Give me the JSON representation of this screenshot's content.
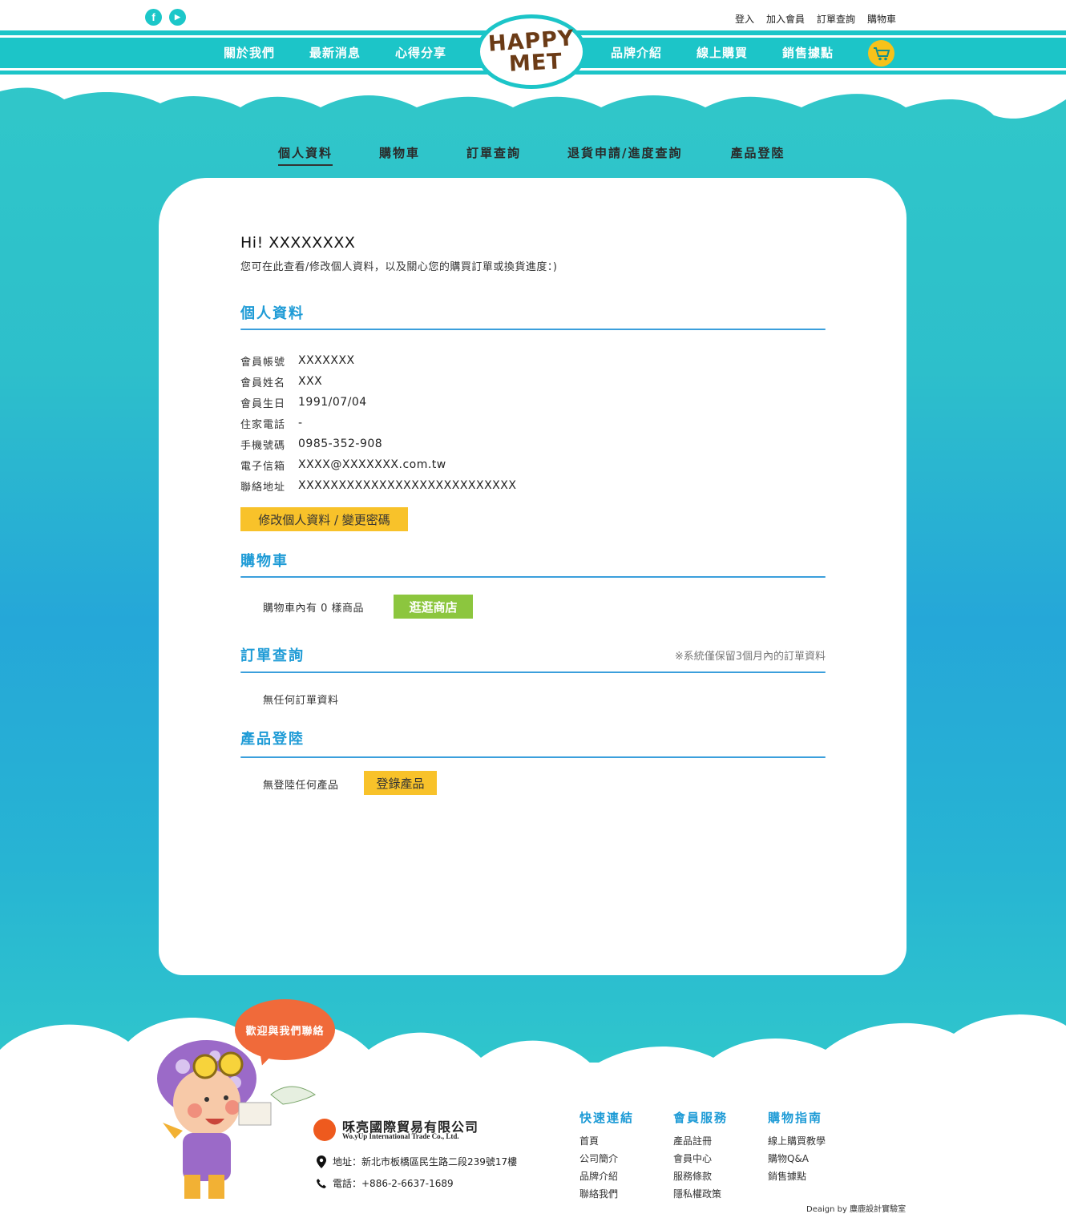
{
  "header": {
    "social": [
      {
        "icon": "facebook-icon",
        "glyph": "f"
      },
      {
        "icon": "youtube-icon",
        "glyph": "▶"
      }
    ],
    "top_links": [
      "登入",
      "加入會員",
      "訂單查詢",
      "購物車"
    ],
    "nav_left": [
      "關於我們",
      "最新消息",
      "心得分享"
    ],
    "nav_right": [
      "品牌介紹",
      "線上購買",
      "銷售據點"
    ],
    "logo": {
      "line1": "HAPPY",
      "line2": "MET"
    }
  },
  "subnav": {
    "items": [
      "個人資料",
      "購物車",
      "訂單查詢",
      "退貨申請/進度查詢",
      "產品登陸"
    ],
    "active": "個人資料"
  },
  "greeting": {
    "title": "Hi! XXXXXXXX",
    "subtitle": "您可在此查看/修改個人資料，以及關心您的購買訂單或換貨進度：)"
  },
  "profile": {
    "title": "個人資料",
    "rows": [
      {
        "label": "會員帳號",
        "value": "XXXXXXX"
      },
      {
        "label": "會員姓名",
        "value": "XXX"
      },
      {
        "label": "會員生日",
        "value": "1991/07/04"
      },
      {
        "label": "住家電話",
        "value": "-"
      },
      {
        "label": "手機號碼",
        "value": "0985-352-908"
      },
      {
        "label": "電子信箱",
        "value": "XXXX@XXXXXXX.com.tw"
      },
      {
        "label": "聯絡地址",
        "value": "XXXXXXXXXXXXXXXXXXXXXXXXXXX"
      }
    ],
    "edit_button": "修改個人資料 / 變更密碼"
  },
  "cart": {
    "title": "購物車",
    "text": "購物車內有 0 樣商品",
    "button": "逛逛商店"
  },
  "orders": {
    "title": "訂單查詢",
    "note": "※系統僅保留3個月內的訂單資料",
    "text": "無任何訂單資料"
  },
  "products": {
    "title": "產品登陸",
    "text": "無登陸任何產品",
    "button": "登錄產品"
  },
  "footer": {
    "bubble": "歡迎與我們聯絡",
    "company_name": "咊亮國際貿易有限公司",
    "company_en": "Wo.yUp International Trade Co., Ltd.",
    "address": "地址：新北市板橋區民生路二段239號17樓",
    "phone": "電話：+886-2-6637-1689",
    "columns": [
      {
        "title": "快速連結",
        "items": [
          "首頁",
          "公司簡介",
          "品牌介紹",
          "聯絡我們"
        ]
      },
      {
        "title": "會員服務",
        "items": [
          "產品註冊",
          "會員中心",
          "服務條款",
          "隱私權政策"
        ]
      },
      {
        "title": "購物指南",
        "items": [
          "線上購買教學",
          "購物Q&A",
          "銷售據點"
        ]
      }
    ],
    "credit": "Deaign by 麋鹿設計實驗室"
  },
  "colors": {
    "teal": "#1cc5c8",
    "blue_heading": "#1e9bd6",
    "yellow": "#f8c22a",
    "green": "#8cc63e",
    "orange": "#f06a3a"
  }
}
